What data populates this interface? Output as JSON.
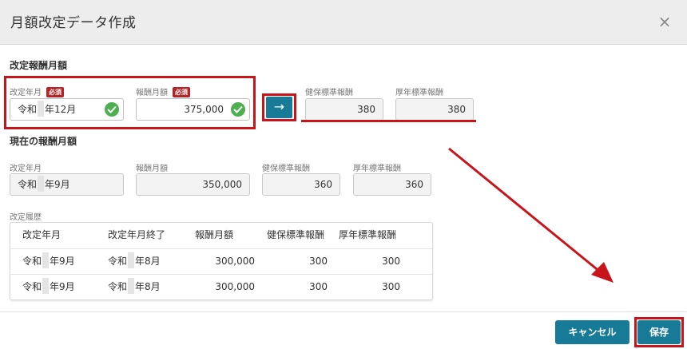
{
  "dialog": {
    "title": "月額改定データ作成",
    "close_glyph": "×"
  },
  "new_section": {
    "title": "改定報酬月額",
    "revision_label": "改定年月",
    "revision_value_prefix": "令和",
    "revision_value_suffix": "年12月",
    "amount_label": "報酬月額",
    "amount_value": "375,000",
    "required_badge": "必須",
    "health_label": "健保標準報酬",
    "health_value": "380",
    "pension_label": "厚年標準報酬",
    "pension_value": "380",
    "arrow_glyph": "→"
  },
  "current_section": {
    "title": "現在の報酬月額",
    "revision_label": "改定年月",
    "revision_value_prefix": "令和",
    "revision_value_suffix": "年9月",
    "amount_label": "報酬月額",
    "amount_value": "350,000",
    "health_label": "健保標準報酬",
    "health_value": "360",
    "pension_label": "厚年標準報酬",
    "pension_value": "360"
  },
  "history": {
    "label": "改定履歴",
    "columns": [
      "改定年月",
      "改定年月終了",
      "報酬月額",
      "健保標準報酬",
      "厚年標準報酬"
    ],
    "rows": [
      {
        "start_prefix": "令和",
        "start_suffix": "年9月",
        "end_prefix": "令和",
        "end_suffix": "年8月",
        "amount": "300,000",
        "health": "300",
        "pension": "300"
      },
      {
        "start_prefix": "令和",
        "start_suffix": "年9月",
        "end_prefix": "令和",
        "end_suffix": "年8月",
        "amount": "300,000",
        "health": "300",
        "pension": "300"
      }
    ]
  },
  "footer": {
    "cancel_label": "キャンセル",
    "save_label": "保存"
  },
  "colors": {
    "accent": "#177a96",
    "highlight": "#c8151c",
    "required_badge": "#b32428",
    "check": "#4caf50"
  }
}
